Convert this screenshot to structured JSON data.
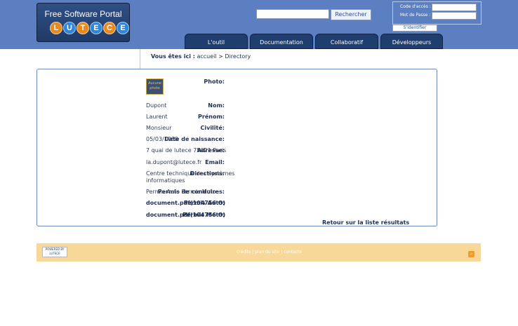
{
  "header": {
    "logo_title": "Free Software Portal",
    "logo_letters": [
      "L",
      "U",
      "T",
      "E",
      "C",
      "E"
    ],
    "logo_colors": [
      "#e8891d",
      "#2d86d8",
      "#e8891d",
      "#2d86d8",
      "#e8891d",
      "#2d86d8"
    ],
    "search_button": "Rechercher",
    "login": {
      "code_label": "Code d'accès :",
      "password_label": "Mot de Passe :",
      "submit_label": "S'identifier"
    }
  },
  "nav": {
    "tabs": [
      "L'outil",
      "Documentation",
      "Collaboratif",
      "Développeurs"
    ]
  },
  "breadcrumb": {
    "label": "Vous êtes ici :",
    "home": "accueil",
    "separator": ">",
    "current": "Directory"
  },
  "record": {
    "fields": [
      {
        "label": "Photo:",
        "value": ""
      },
      {
        "label": "Nom:",
        "value": "Dupont"
      },
      {
        "label": "Prénom:",
        "value": "Laurent"
      },
      {
        "label": "Civilité:",
        "value": "Monsieur"
      },
      {
        "label": "Date de naissance:",
        "value": "05/03/1980"
      },
      {
        "label": "Adresse:",
        "value": "7 quai de lutece 75021 Paris"
      },
      {
        "label": "Email:",
        "value": "la.dupont@lutece.fr"
      },
      {
        "label": "Directions:",
        "value": "Centre technique des systèmes"
      },
      {
        "label": "",
        "value": "informatiques"
      },
      {
        "label": "Permis de conduires:",
        "value": "Permis Auto Permis Moto"
      },
      {
        "label": "Permis Auto:",
        "value": "document.pdf(104756 O)"
      },
      {
        "label": "Permis Moto:",
        "value": "document.pdf(104756 O)"
      }
    ],
    "photo_text": "Aucune photo",
    "back_link": "Retour sur la liste résultats"
  },
  "footer": {
    "links": "crédits | plan du site | contacts",
    "powered": "POWERED BY LUTECE",
    "rss_icon": "rss-icon"
  }
}
